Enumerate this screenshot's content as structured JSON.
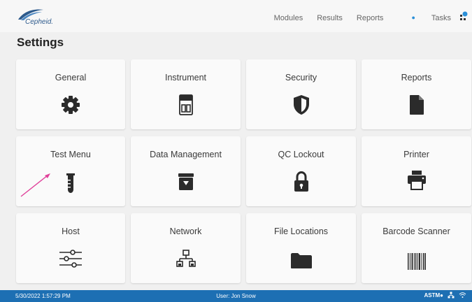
{
  "header": {
    "logo_text": "Cepheid.",
    "nav": [
      {
        "label": "Modules"
      },
      {
        "label": "Results"
      },
      {
        "label": "Reports"
      },
      {
        "label": "Tasks"
      }
    ]
  },
  "page": {
    "title": "Settings"
  },
  "tiles": [
    {
      "label": "General",
      "icon": "gear-icon"
    },
    {
      "label": "Instrument",
      "icon": "instrument-icon"
    },
    {
      "label": "Security",
      "icon": "shield-icon"
    },
    {
      "label": "Reports",
      "icon": "document-icon"
    },
    {
      "label": "Test Menu",
      "icon": "test-tube-icon"
    },
    {
      "label": "Data Management",
      "icon": "archive-icon"
    },
    {
      "label": "QC Lockout",
      "icon": "lock-icon"
    },
    {
      "label": "Printer",
      "icon": "printer-icon"
    },
    {
      "label": "Host",
      "icon": "sliders-icon"
    },
    {
      "label": "Network",
      "icon": "network-icon"
    },
    {
      "label": "File Locations",
      "icon": "folder-icon"
    },
    {
      "label": "Barcode Scanner",
      "icon": "barcode-icon"
    }
  ],
  "status": {
    "datetime": "5/30/2022 1:57:29 PM",
    "user": "User: Jon Snow",
    "protocol": "ASTM"
  },
  "colors": {
    "status_bar": "#1d6fb3",
    "accent": "#2a8fd8",
    "annotation_arrow": "#e0409a"
  }
}
